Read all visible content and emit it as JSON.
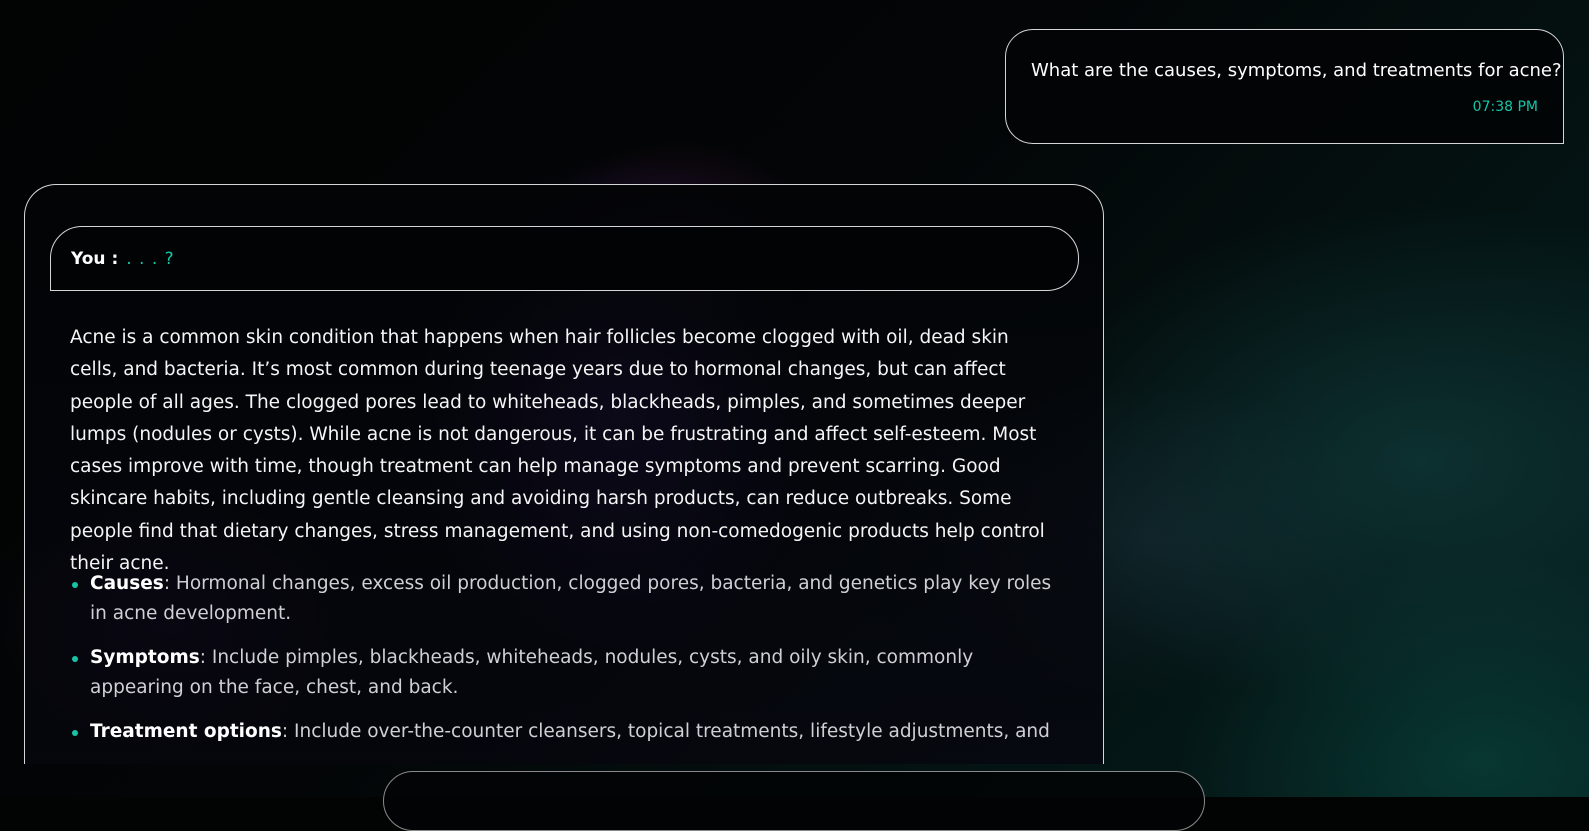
{
  "user_message": {
    "text": "What are the causes, symptoms, and treatments for acne?",
    "time": "07:38 PM"
  },
  "assistant": {
    "you_label": "You :",
    "you_value": ". . . ?",
    "paragraph": "Acne is a common skin condition that happens when hair follicles become clogged with oil, dead skin cells, and bacteria. It’s most common during teenage years due to hormonal changes, but can affect people of all ages. The clogged pores lead to whiteheads, blackheads, pimples, and sometimes deeper lumps (nodules or cysts). While acne is not dangerous, it can be frustrating and affect self-esteem. Most cases improve with time, though treatment can help manage symptoms and prevent scarring. Good skincare habits, including gentle cleansing and avoiding harsh products, can reduce outbreaks. Some people find that dietary changes, stress management, and using non-comedogenic products help control their acne.",
    "items": [
      {
        "title": "Causes",
        "text": ": Hormonal changes, excess oil production, clogged pores, bacteria, and genetics play key roles in acne development."
      },
      {
        "title": "Symptoms",
        "text": ": Include pimples, blackheads, whiteheads, nodules, cysts, and oily skin, commonly appearing on the face, chest, and back."
      },
      {
        "title": "Treatment options",
        "text": ": Include over-the-counter cleansers, topical treatments, lifestyle adjustments, and"
      }
    ]
  },
  "colors": {
    "accent": "#18c4a6",
    "border": "#d6d6d6",
    "background": "#020404"
  }
}
